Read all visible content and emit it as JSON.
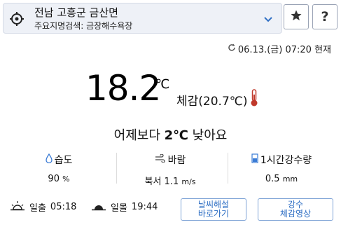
{
  "location": {
    "title": "전남 고흥군 금산면",
    "search_label": "주요지명검색: 금장해수욕장"
  },
  "updated": "06.13.(금) 07:20 현재",
  "current": {
    "temperature": "18.2",
    "unit": "℃",
    "feels_like": "체감(20.7℃)",
    "comparison_prefix": "어제보다 ",
    "comparison_value": "2℃",
    "comparison_suffix": " 낮아요"
  },
  "stats": [
    {
      "label": "습도",
      "value": "90",
      "unit": "%",
      "icon": "droplet-icon"
    },
    {
      "label": "바람",
      "value": "북서 1.1",
      "unit": "m/s",
      "icon": "wind-icon"
    },
    {
      "label": "1시간강수량",
      "value": "0.5",
      "unit": "mm",
      "icon": "rain-gauge-icon"
    }
  ],
  "sun": {
    "sunrise_label": "일출",
    "sunrise_time": "05:18",
    "sunset_label": "일몰",
    "sunset_time": "19:44"
  },
  "buttons": {
    "briefing_line1": "날씨해설",
    "briefing_line2": "바로가기",
    "rain_line1": "강수",
    "rain_line2": "체감영상"
  },
  "colors": {
    "accent": "#2f6fc4",
    "thermo": "#c0392b",
    "droplet": "#3a7bd5"
  }
}
